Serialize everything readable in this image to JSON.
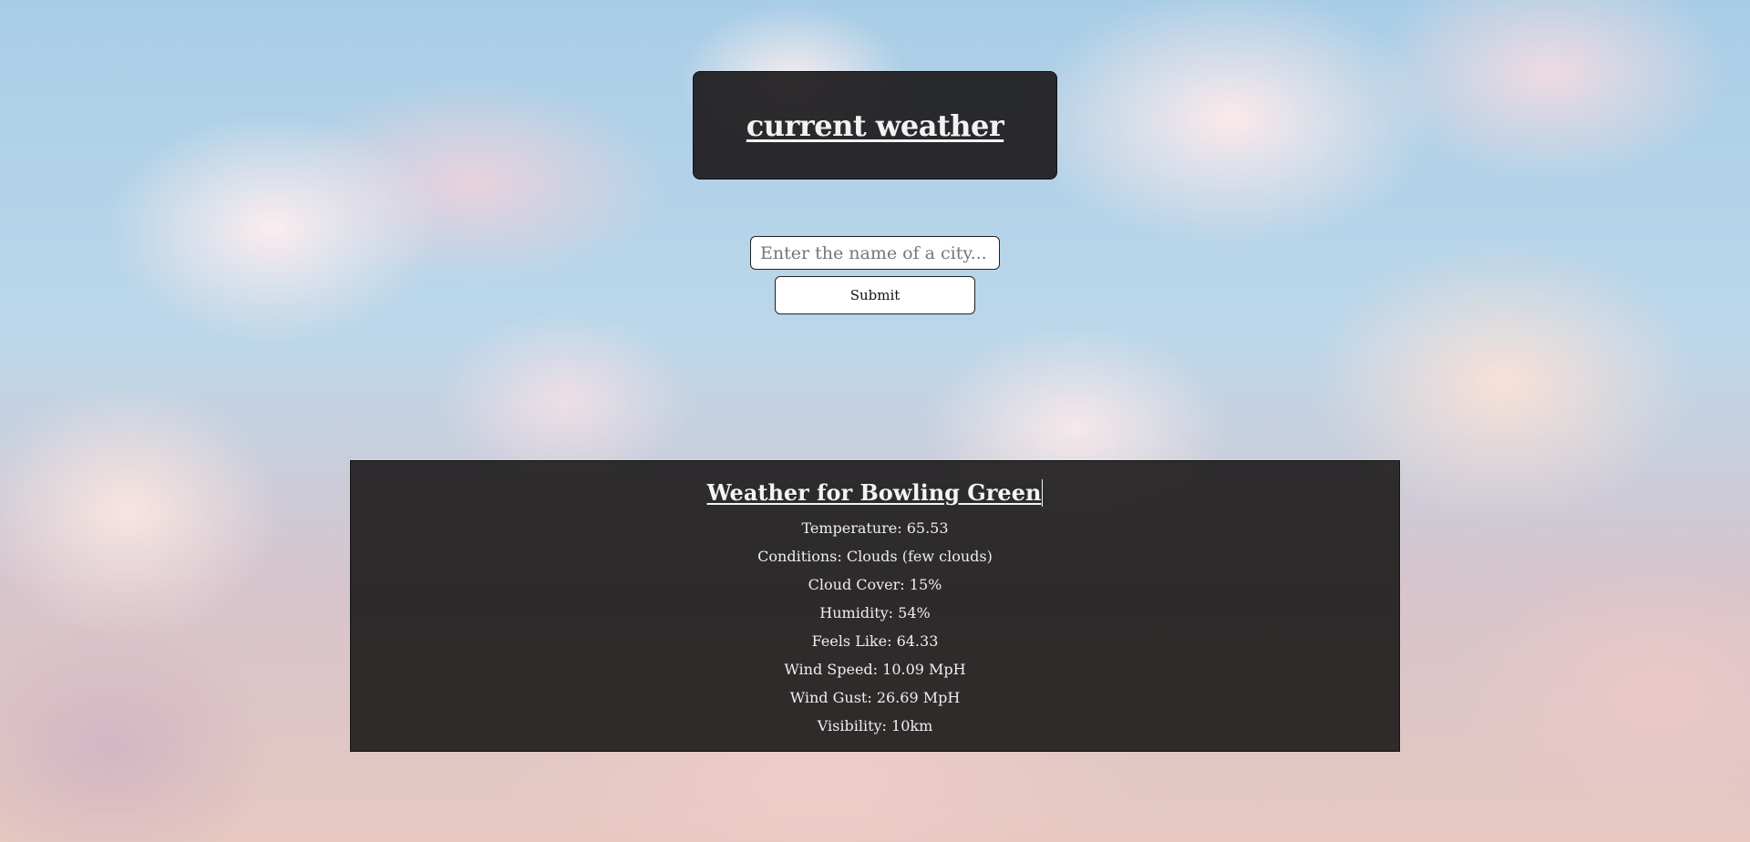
{
  "header": {
    "title": "current weather"
  },
  "search": {
    "placeholder": "Enter the name of a city...",
    "value": "",
    "submit_label": "Submit"
  },
  "results": {
    "title": "Weather for Bowling Green",
    "stats": [
      "Temperature: 65.53",
      "Conditions: Clouds (few clouds)",
      "Cloud Cover: 15%",
      "Humidity: 54%",
      "Feels Like: 64.33",
      "Wind Speed: 10.09 MpH",
      "Wind Gust: 26.69 MpH",
      "Visibility: 10km"
    ]
  }
}
